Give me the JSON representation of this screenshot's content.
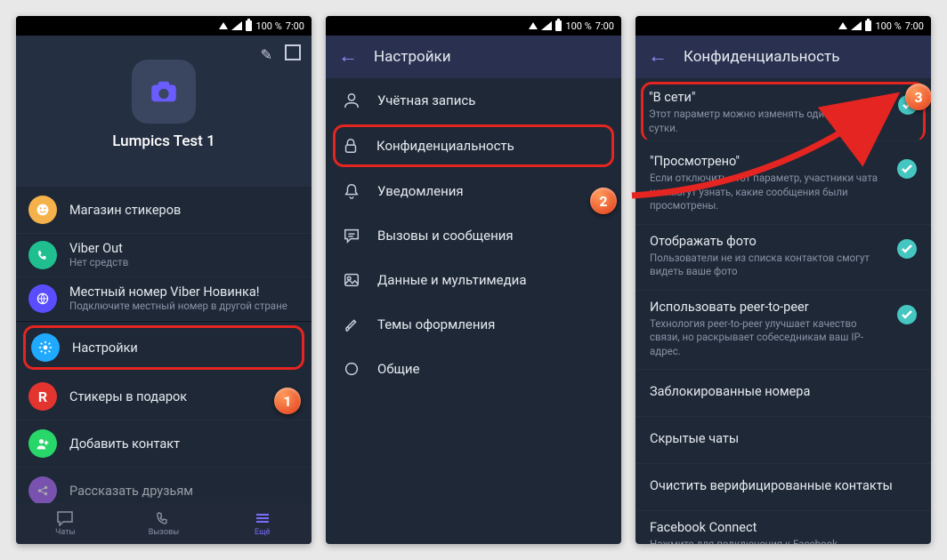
{
  "status": {
    "battery_text": "100 %",
    "time": "7:00"
  },
  "screen1": {
    "profile_name": "Lumpics Test 1",
    "items": [
      {
        "title": "Магазин стикеров",
        "sub": "",
        "color": "#f6b24a",
        "icon": "bear"
      },
      {
        "title": "Viber Out",
        "sub": "Нет средств",
        "color": "#1fbf8f",
        "icon": "phone"
      },
      {
        "title": "Местный номер Viber",
        "badge": "Новинка!",
        "sub": "Подключите местный номер в другой стране",
        "color": "#5a4dff",
        "icon": "globe"
      },
      {
        "title": "Настройки",
        "sub": "",
        "color": "#1fa9ff",
        "icon": "gear"
      },
      {
        "title": "Стикеры в подарок",
        "sub": "",
        "color": "#e3342f",
        "icon": "r"
      },
      {
        "title": "Добавить контакт",
        "sub": "",
        "color": "#29d66a",
        "icon": "plususer"
      },
      {
        "title": "Рассказать друзьям",
        "sub": "",
        "color": "#b56eff",
        "icon": "share"
      }
    ],
    "nav": {
      "chats": "Чаты",
      "calls": "Вызовы",
      "more": "Ещё"
    }
  },
  "screen2": {
    "title": "Настройки",
    "items": [
      "Учётная запись",
      "Конфиденциальность",
      "Уведомления",
      "Вызовы и сообщения",
      "Данные и мультимедиа",
      "Темы оформления",
      "Общие"
    ]
  },
  "screen3": {
    "title": "Конфиденциальность",
    "toggles": [
      {
        "title": "\"В сети\"",
        "sub": "Этот параметр можно изменять один раз в сутки."
      },
      {
        "title": "\"Просмотрено\"",
        "sub": "Если отключить этот параметр, участники чата не смогут узнать, какие сообщения были просмотрены."
      },
      {
        "title": "Отображать фото",
        "sub": "Пользователи не из списка контактов смогут видеть ваше фото"
      },
      {
        "title": "Использовать peer-to-peer",
        "sub": "Технология peer-to-peer улучшает качество связи, но раскрывает собеседникам ваш IP-адрес."
      }
    ],
    "links": [
      "Заблокированные номера",
      "Скрытые чаты",
      "Очистить верифицированные контакты"
    ],
    "fb": {
      "title": "Facebook Connect",
      "sub": "Нажмите для подключения к Facebook"
    }
  },
  "badges": {
    "b1": "1",
    "b2": "2",
    "b3": "3"
  }
}
